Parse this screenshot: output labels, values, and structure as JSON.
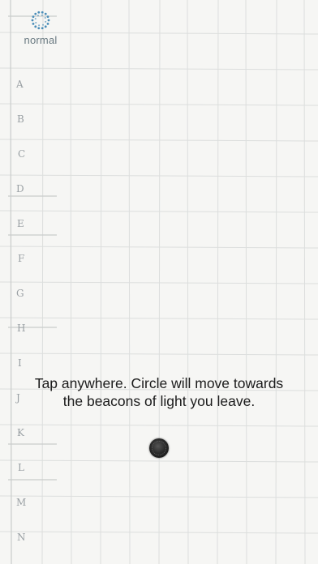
{
  "mode": {
    "label": "normal",
    "icon": "dotted-ring-icon",
    "icon_color": "#4a8db8"
  },
  "instruction": {
    "text": "Tap anywhere. Circle will move towards the beacons of light you leave."
  },
  "player": {
    "icon": "circle-icon",
    "color": "#1a1a1a"
  },
  "background": {
    "style": "hand-drawn faint grid paper",
    "row_labels": [
      "A",
      "B",
      "C",
      "D",
      "E",
      "F",
      "G",
      "H",
      "I",
      "J",
      "K",
      "L",
      "M",
      "N"
    ],
    "label_color": "#9aa0a4"
  }
}
